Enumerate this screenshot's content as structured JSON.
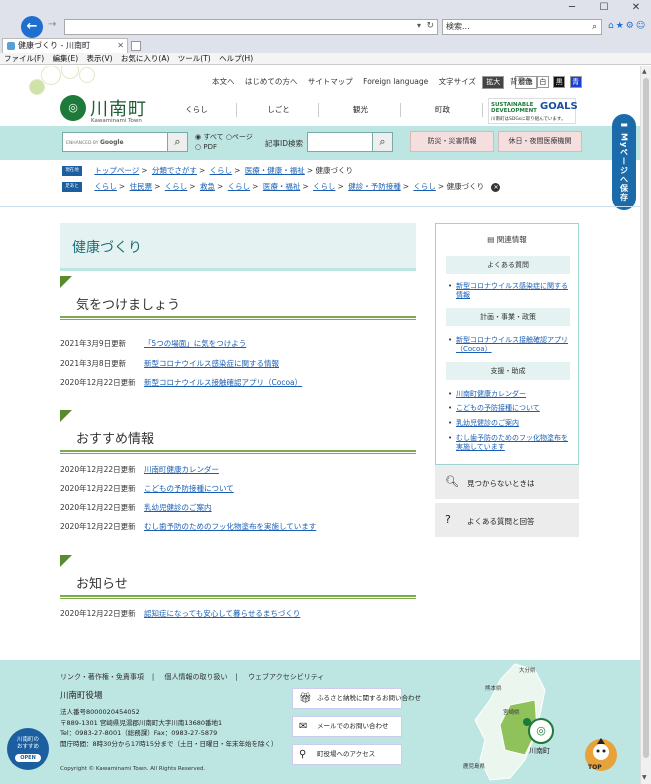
{
  "browser": {
    "search_placeholder": "検索...",
    "tab_title": "健康づくり - 川南町",
    "menu": [
      "ファイル(F)",
      "編集(E)",
      "表示(V)",
      "お気に入り(A)",
      "ツール(T)",
      "ヘルプ(H)"
    ]
  },
  "header": {
    "util_links": [
      "本文へ",
      "はじめての方へ",
      "サイトマップ",
      "Foreign language"
    ],
    "font_size_label": "文字サイズ",
    "font_size_large": "拡大",
    "font_size_standard": "標準",
    "bg_color_label": "背景色",
    "bg_white": "白",
    "bg_black": "黒",
    "bg_blue": "青",
    "site_name": "川南町",
    "site_name_en": "Kawaminami Town",
    "nav": [
      "くらし",
      "しごと",
      "観光",
      "町政"
    ],
    "sdgs_line1": "SUSTAINABLE",
    "sdgs_line2": "DEVELOPMENT",
    "sdgs_goals": "GOALS",
    "sdgs_sub": "川南町はSDGsに取り組んでいます。",
    "search_brand_small": "ENHANCED BY",
    "search_brand": "Google",
    "radio_all": "すべて",
    "radio_page": "ページ",
    "radio_pdf": "PDF",
    "article_id_label": "記事ID検索",
    "disaster_button": "防災・災害情報",
    "emergency_button": "休日・夜間医療機関",
    "mypage_label": "Myページへ保存"
  },
  "breadcrumb": {
    "current_tag": "現在地",
    "trail_tag": "足あと",
    "current": [
      "トップページ",
      "分類でさがす",
      "くらし",
      "医療・健康・福祉"
    ],
    "current_page": "健康づくり",
    "trail": [
      "くらし",
      "住民票",
      "くらし",
      "救急",
      "くらし",
      "医療・福祉",
      "くらし",
      "健診・予防接種",
      "くらし"
    ],
    "trail_page": "健康づくり",
    "separator": ">"
  },
  "main": {
    "page_title": "健康づくり",
    "sections": [
      {
        "title": "気をつけましょう",
        "items": [
          {
            "date": "2021年3月9日更新",
            "title": "「5つの場面」に気をつけよう"
          },
          {
            "date": "2021年3月8日更新",
            "title": "新型コロナウイルス感染症に関する情報"
          },
          {
            "date": "2020年12月22日更新",
            "title": "新型コロナウイルス接触確認アプリ（Cocoa）"
          }
        ]
      },
      {
        "title": "おすすめ情報",
        "items": [
          {
            "date": "2020年12月22日更新",
            "title": "川南町健康カレンダー"
          },
          {
            "date": "2020年12月22日更新",
            "title": "こどもの予防接種について"
          },
          {
            "date": "2020年12月22日更新",
            "title": "乳幼児健診のご案内"
          },
          {
            "date": "2020年12月22日更新",
            "title": "むし歯予防のためのフッ化物塗布を実施しています"
          }
        ]
      },
      {
        "title": "お知らせ",
        "items": [
          {
            "date": "2020年12月22日更新",
            "title": "認知症になっても安心して暮らせるまちづくり"
          }
        ]
      }
    ]
  },
  "sidebar": {
    "heading": "関連情報",
    "faq_cat": "よくある質問",
    "faq_items": [
      "新型コロナウイルス感染症に関する情報"
    ],
    "plan_cat": "計画・事業・政策",
    "plan_items": [
      "新型コロナウイルス接触確認アプリ（Cocoa）"
    ],
    "support_cat": "支援・助成",
    "support_items": [
      "川南町健康カレンダー",
      "こどもの予防接種について",
      "乳幼児健診のご案内",
      "むし歯予防のためのフッ化物塗布を実施しています"
    ],
    "not_found": "見つからないときは",
    "faq_link": "よくある質問と回答"
  },
  "footer": {
    "links": [
      "リンク・著作権・免責事項",
      "個人情報の取り扱い",
      "ウェブアクセシビリティ"
    ],
    "office_name": "川南町役場",
    "corp_no": "法人番号8000020454052",
    "address": "〒889-1301 宮崎県児湯郡川南町大字川南13680番地1",
    "tel": "Tel：0983-27-8001（総務課）Fax：0983-27-5879",
    "hours": "開庁時間：8時30分から17時15分まで（土日・日曜日・年末年始を除く）",
    "copyright": "Copyright © Kawaminami Town. All Rights Reserved.",
    "btn_furusato": "ふるさと納税に関するお問い合わせ",
    "btn_mail": "メールでのお問い合わせ",
    "btn_access": "町役場へのアクセス",
    "badge_line1": "川南町の",
    "badge_line2": "おすすめ",
    "badge_open": "OPEN",
    "map_oita": "大分県",
    "map_kumamoto": "熊本県",
    "map_miyazaki": "宮崎県",
    "map_kagoshima": "鹿児島県",
    "emblem_label": "川南町",
    "totop_label": "TOP"
  },
  "colors": {
    "teal": "#bde5e1",
    "green": "#5a8a2e",
    "link": "#1a5fb4",
    "mypage": "#1b6bab"
  }
}
